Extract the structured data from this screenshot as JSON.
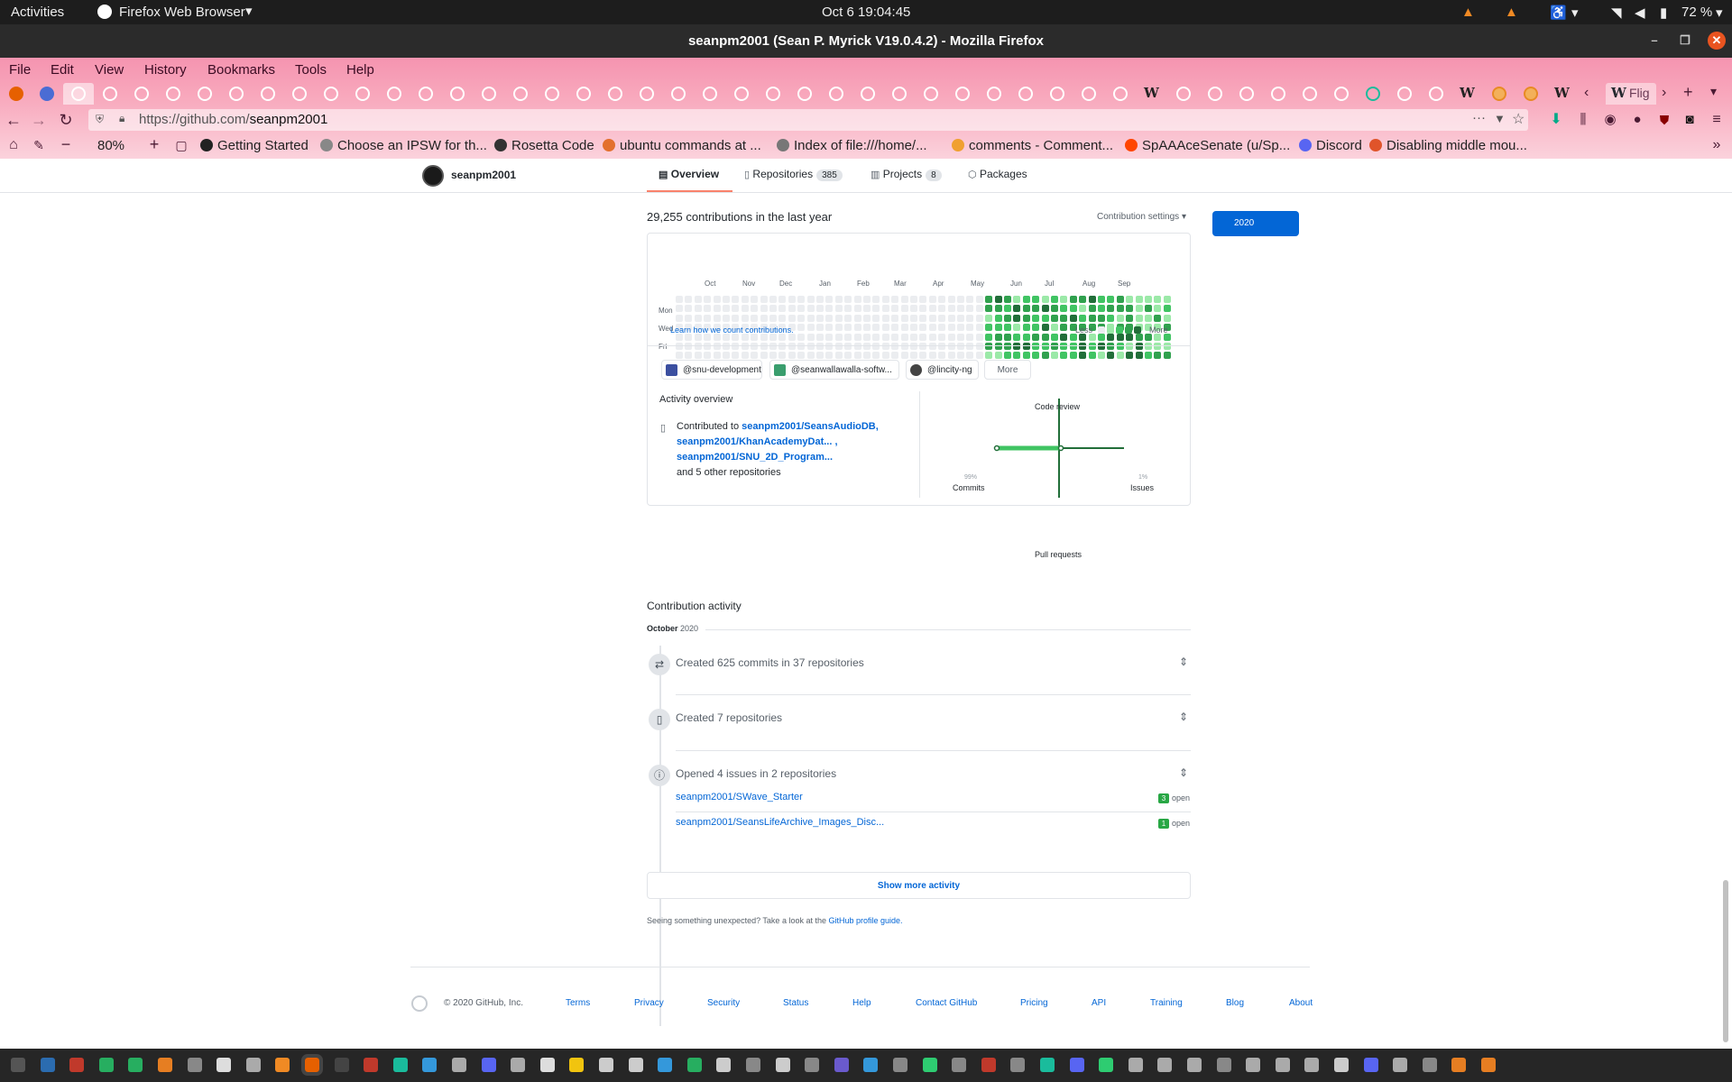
{
  "system": {
    "activities": "Activities",
    "app_menu": "Firefox Web Browser",
    "clock": "Oct 6  19:04:45",
    "battery": "72 %"
  },
  "window": {
    "title": "seanpm2001 (Sean P. Myrick V19.0.4.2) - Mozilla Firefox"
  },
  "menu": [
    "File",
    "Edit",
    "View",
    "History",
    "Bookmarks",
    "Tools",
    "Help"
  ],
  "toolbar": {
    "url_prefix": "https://github.com/",
    "url_path": "seanpm2001",
    "zoom": "80%",
    "overflow_tab_label": "Flig"
  },
  "bookmarks": [
    {
      "label": "Getting Started",
      "color": "#222222"
    },
    {
      "label": "Choose an IPSW for th...",
      "color": "#888888"
    },
    {
      "label": "Rosetta Code",
      "color": "#333333"
    },
    {
      "label": "ubuntu commands at ...",
      "color": "#e3702d"
    },
    {
      "label": "Index of file:///home/...",
      "color": "#777777"
    },
    {
      "label": "comments - Comment...",
      "color": "#f0a030"
    },
    {
      "label": "SpAAAceSenate (u/Sp...",
      "color": "#ff4500"
    },
    {
      "label": "Discord",
      "color": "#5865f2"
    },
    {
      "label": "Disabling middle mou...",
      "color": "#e0542a"
    }
  ],
  "profile": {
    "username": "seanpm2001",
    "tabs": [
      {
        "label": "Overview",
        "count": ""
      },
      {
        "label": "Repositories",
        "count": "385"
      },
      {
        "label": "Projects",
        "count": "8"
      },
      {
        "label": "Packages",
        "count": ""
      }
    ]
  },
  "contributions": {
    "summary": "29,255 contributions in the last year",
    "settings": "Contribution settings",
    "year": "2020",
    "months": [
      "Oct",
      "Nov",
      "Dec",
      "Jan",
      "Feb",
      "Mar",
      "Apr",
      "May",
      "Jun",
      "Jul",
      "Aug",
      "Sep"
    ],
    "days": [
      "Mon",
      "Wed",
      "Fri"
    ],
    "learn_link": "Learn how we count contributions.",
    "less": "Less",
    "more": "More",
    "colors": [
      "#ebedf0",
      "#9be9a8",
      "#40c463",
      "#30a14e",
      "#216e39"
    ]
  },
  "orgs": [
    "@snu-development",
    "@seanwallawalla-softw...",
    "@lincity-ng",
    "More"
  ],
  "activity_overview": {
    "heading": "Activity overview",
    "contributed_to": "Contributed to",
    "repos": [
      "seanpm2001/SeansAudioDB,",
      "seanpm2001/KhanAcademyDat... ,",
      "seanpm2001/SNU_2D_Program..."
    ],
    "others": "and 5 other repositories",
    "axes": {
      "top": "Code review",
      "left": "Commits",
      "right": "Issues",
      "bottom": "Pull requests",
      "left_pct": "99%",
      "right_pct": "1%"
    }
  },
  "contribution_activity": {
    "heading": "Contribution activity",
    "month": "October",
    "year": "2020",
    "items": [
      {
        "text": "Created 625 commits in 37 repositories"
      },
      {
        "text": "Created 7 repositories"
      },
      {
        "text": "Opened 4 issues in 2 repositories"
      }
    ],
    "issues": [
      {
        "repo": "seanpm2001/SWave_Starter",
        "count": "3",
        "state": "open"
      },
      {
        "repo": "seanpm2001/SeansLifeArchive_Images_Disc...",
        "count": "1",
        "state": "open"
      }
    ],
    "show_more": "Show more activity",
    "unexpected_prefix": "Seeing something unexpected? Take a look at the",
    "unexpected_link": "GitHub profile guide."
  },
  "footer": {
    "copyright": "© 2020 GitHub, Inc.",
    "links": [
      "Terms",
      "Privacy",
      "Security",
      "Status",
      "Help",
      "Contact GitHub",
      "Pricing",
      "API",
      "Training",
      "Blog",
      "About"
    ]
  }
}
